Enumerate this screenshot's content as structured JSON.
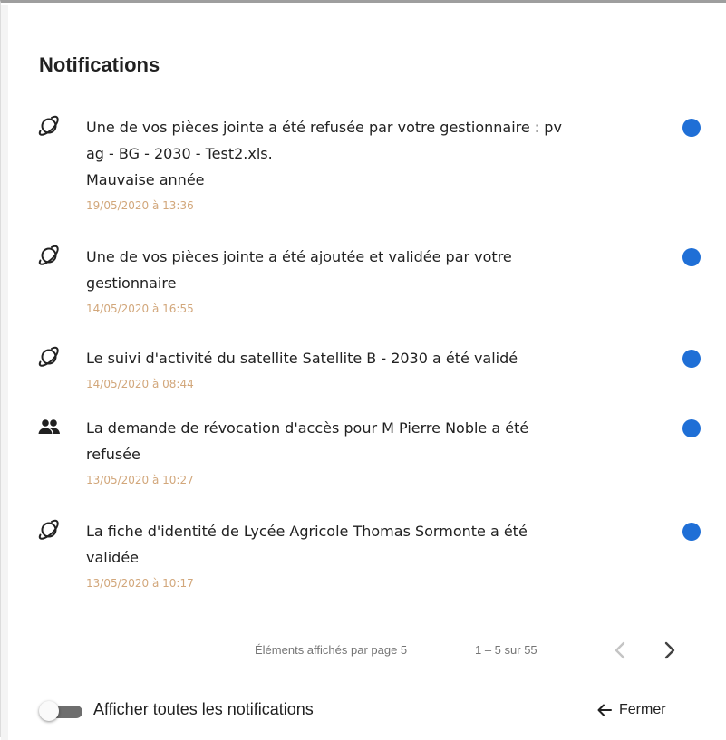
{
  "panel": {
    "title": "Notifications"
  },
  "notifications": [
    {
      "icon": "satellite-icon",
      "lines": [
        "Une de vos pièces jointe a été refusée par votre gestionnaire : pv",
        "ag - BG - 2030 - Test2.xls.",
        "Mauvaise année"
      ],
      "date": "19/05/2020 à 13:36",
      "unread": true
    },
    {
      "icon": "satellite-icon",
      "lines": [
        "Une de vos pièces jointe a été ajoutée et validée par votre",
        "gestionnaire"
      ],
      "date": "14/05/2020 à 16:55",
      "unread": true
    },
    {
      "icon": "satellite-icon",
      "lines": [
        "Le suivi d'activité du satellite Satellite B - 2030 a été validé"
      ],
      "date": "14/05/2020 à 08:44",
      "unread": true
    },
    {
      "icon": "people-icon",
      "lines": [
        "La demande de révocation d'accès pour M Pierre Noble a été",
        "refusée"
      ],
      "date": "13/05/2020 à 10:27",
      "unread": true
    },
    {
      "icon": "satellite-icon",
      "lines": [
        "La fiche d'identité de Lycée Agricole Thomas Sormonte a été",
        "validée"
      ],
      "date": "13/05/2020 à 10:17",
      "unread": true
    }
  ],
  "paginator": {
    "label": "Éléments affichés par page 5",
    "range": "1 – 5 sur 55"
  },
  "footer": {
    "toggle_label": "Afficher toutes les notifications",
    "toggle_on": false,
    "close_label": "Fermer"
  },
  "colors": {
    "unread_dot": "#1f6fd6",
    "date_text": "#d2a77b"
  }
}
